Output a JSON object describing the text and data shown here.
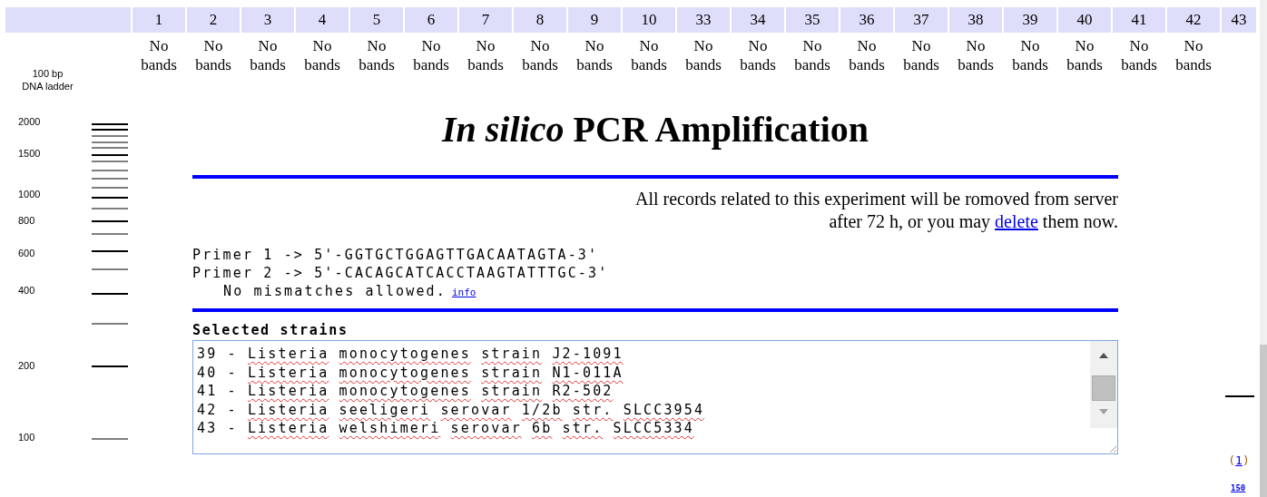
{
  "lanes": [
    {
      "number": "1",
      "kind": "empty",
      "result": [
        "No",
        "bands"
      ]
    },
    {
      "number": "2",
      "kind": "empty",
      "result": [
        "No",
        "bands"
      ]
    },
    {
      "number": "3",
      "kind": "empty",
      "result": [
        "No",
        "bands"
      ]
    },
    {
      "number": "4",
      "kind": "empty",
      "result": [
        "No",
        "bands"
      ]
    },
    {
      "number": "5",
      "kind": "empty",
      "result": [
        "No",
        "bands"
      ]
    },
    {
      "number": "6",
      "kind": "empty",
      "result": [
        "No",
        "bands"
      ]
    },
    {
      "number": "7",
      "kind": "empty",
      "result": [
        "No",
        "bands"
      ]
    },
    {
      "number": "8",
      "kind": "empty",
      "result": [
        "No",
        "bands"
      ]
    },
    {
      "number": "9",
      "kind": "empty",
      "result": [
        "No",
        "bands"
      ]
    },
    {
      "number": "10",
      "kind": "empty",
      "result": [
        "No",
        "bands"
      ]
    },
    {
      "number": "33",
      "kind": "empty",
      "result": [
        "No",
        "bands"
      ]
    },
    {
      "number": "34",
      "kind": "empty",
      "result": [
        "No",
        "bands"
      ]
    },
    {
      "number": "35",
      "kind": "empty",
      "result": [
        "No",
        "bands"
      ]
    },
    {
      "number": "36",
      "kind": "empty",
      "result": [
        "No",
        "bands"
      ]
    },
    {
      "number": "37",
      "kind": "empty",
      "result": [
        "No",
        "bands"
      ]
    },
    {
      "number": "38",
      "kind": "empty",
      "result": [
        "No",
        "bands"
      ]
    },
    {
      "number": "39",
      "kind": "empty",
      "result": [
        "No",
        "bands"
      ]
    },
    {
      "number": "40",
      "kind": "empty",
      "result": [
        "No",
        "bands"
      ]
    },
    {
      "number": "41",
      "kind": "empty",
      "result": [
        "No",
        "bands"
      ]
    },
    {
      "number": "42",
      "kind": "empty",
      "result": [
        "No",
        "bands"
      ]
    },
    {
      "number": "43",
      "kind": "band",
      "count_open": "(",
      "count_link": "1",
      "count_close": ")",
      "size_link": "150"
    }
  ],
  "ladder": {
    "title": [
      "100 bp",
      "DNA ladder"
    ],
    "labels": [
      "2000",
      "1500",
      "1000",
      "800",
      "600",
      "400",
      "200",
      "100"
    ]
  },
  "main": {
    "title": "*In silico* PCR Amplification",
    "notice": {
      "line_1": "All records related to this experiment will be romoved from server",
      "before_link": "after 72 h, or you may",
      "link": "delete",
      "after_link": "them now."
    },
    "primers": [
      "Primer 1 -> 5'-GGTGCTGGAGTTGACAATAGTA-3'",
      "Primer 2 -> 5'-CACAGCATCACCTAAGTATTTGC-3'"
    ],
    "mismatch": {
      "text": "No mismatches allowed.",
      "link": "info"
    },
    "strains_label": "Selected strains",
    "strains": [
      "39 - Listeria monocytogenes strain J2-1091",
      "40 - Listeria monocytogenes strain N1-011A",
      "41 - Listeria monocytogenes strain R2-502",
      "42 - Listeria seeligeri serovar 1/2b str. SLCC3954",
      "43 - Listeria welshimeri serovar 6b str. SLCC5334"
    ]
  }
}
